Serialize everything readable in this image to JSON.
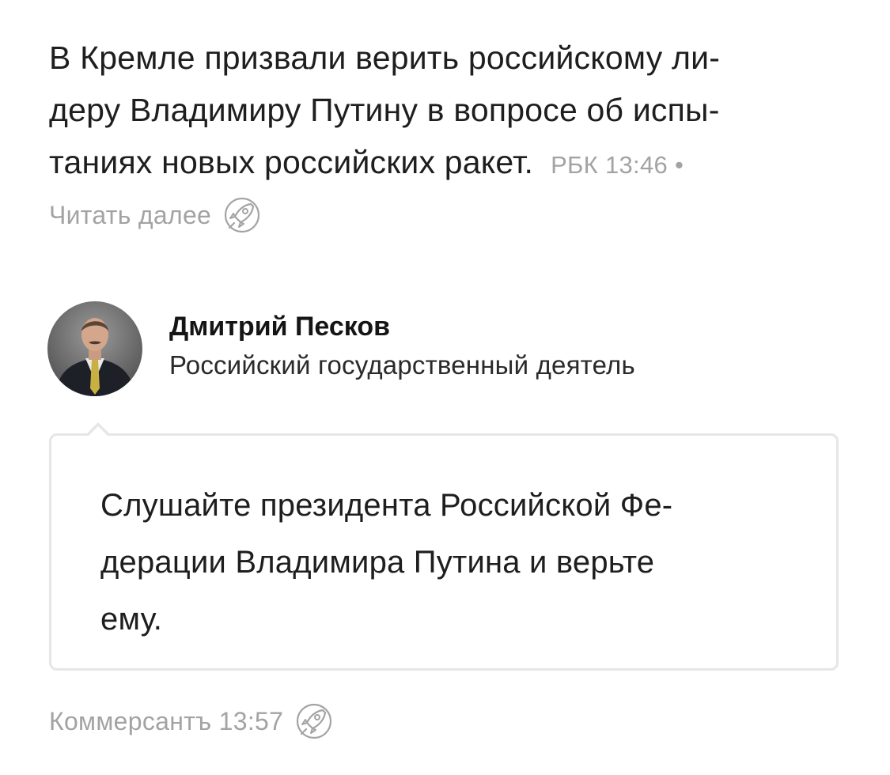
{
  "news": {
    "headline_lines": [
      "В Кремле призвали верить российскому ли-",
      "деру Владимиру Путину в вопросе об испы-",
      "таниях новых российских ракет."
    ],
    "source_meta": "РБК 13:46 •",
    "read_more": "Читать далее",
    "read_more_icon": "rocket-icon"
  },
  "person": {
    "name": "Дмитрий Песков",
    "role": "Российский государственный деятель",
    "avatar_icon": "avatar-photo"
  },
  "quote": {
    "lines": [
      "Слушайте президента Российской Фе-",
      "дерации Владимира Путина и верьте",
      "ему."
    ]
  },
  "footer": {
    "source_meta": "Коммерсантъ 13:57",
    "icon": "rocket-icon"
  },
  "colors": {
    "text": "#1e1e1e",
    "muted": "#a3a3a3",
    "card_border": "#e6e6e6"
  }
}
